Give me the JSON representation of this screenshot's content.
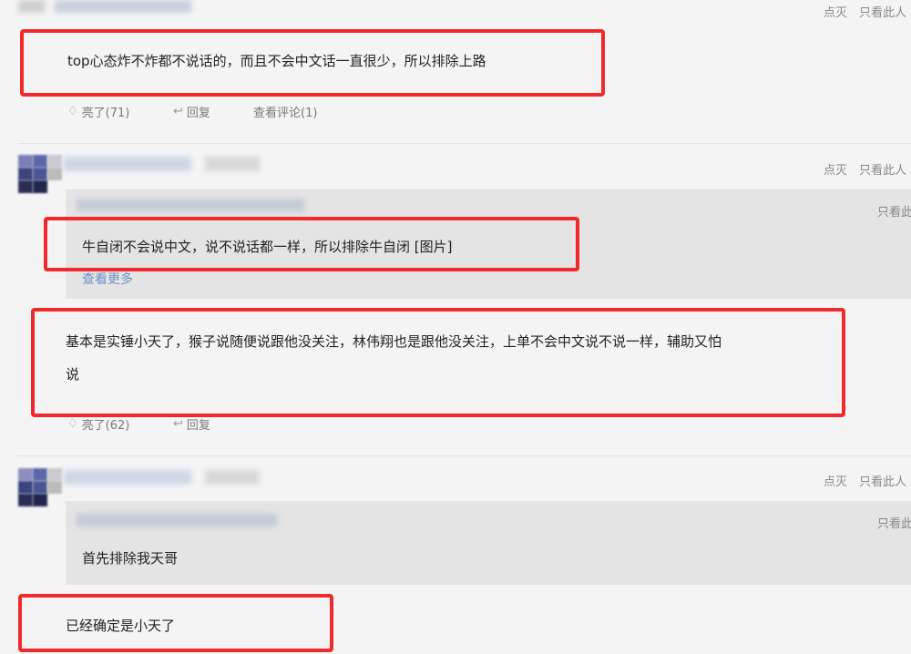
{
  "comments": [
    {
      "text": "top心态炸不炸都不说话的，而且不会中文话一直很少，所以排除上路",
      "meta": {
        "vote_down": "点灭",
        "only_view": "只看此人"
      },
      "actions": {
        "like": "亮了(71)",
        "reply": "回复",
        "view_comments": "查看评论(1)"
      }
    },
    {
      "meta": {
        "vote_down": "点灭",
        "only_view": "只看此人"
      },
      "quote": {
        "only_view": "只看此",
        "text": "牛自闭不会说中文，说不说话都一样，所以排除牛自闭 [图片]",
        "more": "查看更多"
      },
      "text_line1": "基本是实锤小天了，猴子说随便说跟他没关注，林伟翔也是跟他没关注，上单不会中文说不说一样，辅助又怕",
      "text_line2": "说",
      "actions": {
        "like": "亮了(62)",
        "reply": "回复"
      }
    },
    {
      "meta": {
        "vote_down": "点灭",
        "only_view": "只看此人"
      },
      "quote": {
        "only_view": "只看此",
        "text": "首先排除我天哥"
      },
      "text": "已经确定是小天了"
    }
  ],
  "colors": {
    "highlight_border": "#f0292a",
    "link": "#6b8fc9",
    "quote_bg": "#e4e4e4",
    "page_bg": "#f4f4f5"
  }
}
